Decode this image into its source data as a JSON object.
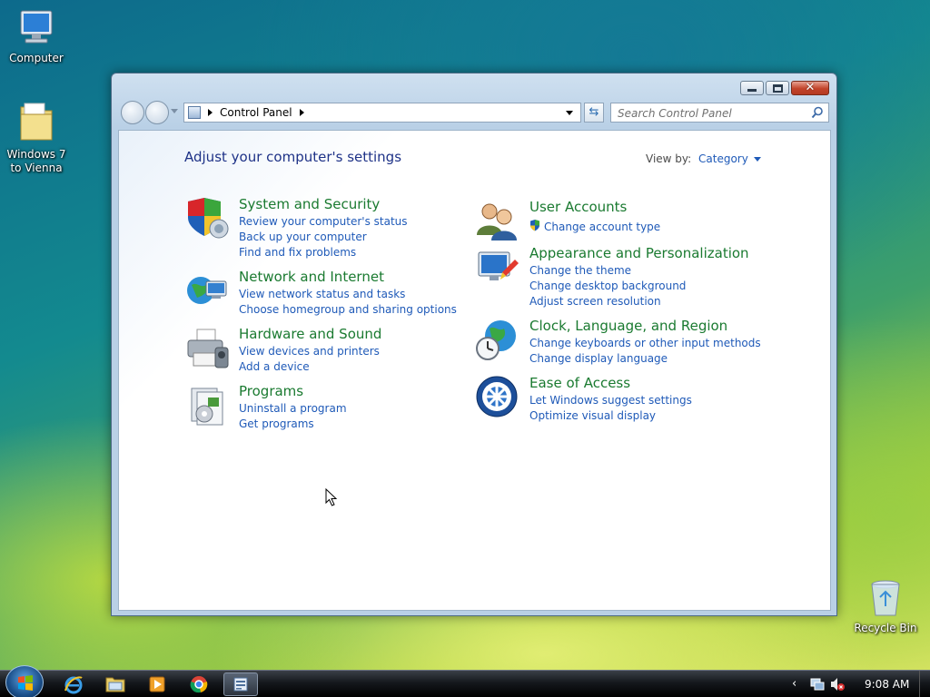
{
  "desktop": {
    "icons": [
      {
        "label": "Computer"
      },
      {
        "label": "Windows 7 to Vienna"
      },
      {
        "label": "Recycle Bin"
      }
    ]
  },
  "window": {
    "breadcrumb": {
      "root": "Control Panel"
    },
    "search": {
      "placeholder": "Search Control Panel"
    },
    "heading": "Adjust your computer's settings",
    "view_by": {
      "label": "View by:",
      "value": "Category"
    },
    "categories": [
      {
        "title": "System and Security",
        "icon": "shield-icon",
        "links": [
          "Review your computer's status",
          "Back up your computer",
          "Find and fix problems"
        ]
      },
      {
        "title": "Network and Internet",
        "icon": "network-globe-icon",
        "links": [
          "View network status and tasks",
          "Choose homegroup and sharing options"
        ]
      },
      {
        "title": "Hardware and Sound",
        "icon": "printer-icon",
        "links": [
          "View devices and printers",
          "Add a device"
        ]
      },
      {
        "title": "Programs",
        "icon": "programs-icon",
        "links": [
          "Uninstall a program",
          "Get programs"
        ]
      },
      {
        "title": "User Accounts",
        "icon": "users-icon",
        "links": [
          "Change account type"
        ]
      },
      {
        "title": "Appearance and Personalization",
        "icon": "monitor-paint-icon",
        "links": [
          "Change the theme",
          "Change desktop background",
          "Adjust screen resolution"
        ]
      },
      {
        "title": "Clock, Language, and Region",
        "icon": "clock-globe-icon",
        "links": [
          "Change keyboards or other input methods",
          "Change display language"
        ]
      },
      {
        "title": "Ease of Access",
        "icon": "ease-of-access-icon",
        "links": [
          "Let Windows suggest settings",
          "Optimize visual display"
        ]
      }
    ]
  },
  "taskbar": {
    "apps": [
      "internet-explorer-icon",
      "explorer-folder-icon",
      "media-player-icon",
      "chrome-icon",
      "control-panel-icon"
    ],
    "clock": "9:08 AM"
  }
}
